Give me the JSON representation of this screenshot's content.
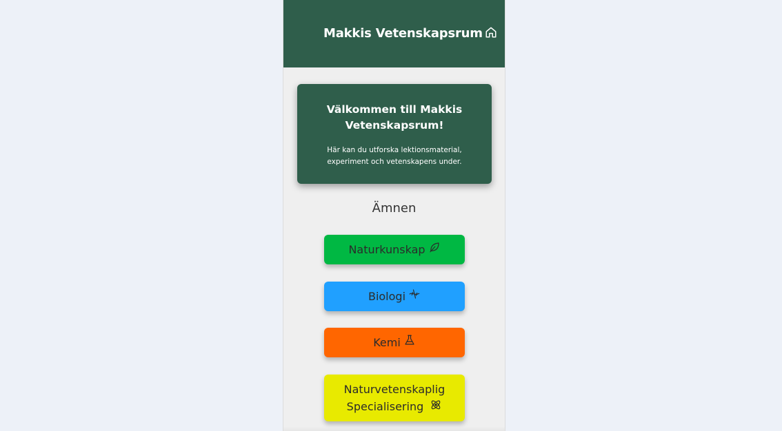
{
  "header": {
    "title": "Makkis Vetenskapsrum",
    "home_icon": "home-icon",
    "background": "#2f5e4b"
  },
  "welcome": {
    "title": "Välkommen till Makkis Vetenskapsrum!",
    "text": "Här kan du utforska lektionsmaterial, experiment och vetenskapens under."
  },
  "subjects": {
    "heading": "Ämnen",
    "items": [
      {
        "label": "Naturkunskap",
        "icon": "leaf-icon",
        "color": "#00b843"
      },
      {
        "label": "Biologi",
        "icon": "dna-icon",
        "color": "#20a0ff"
      },
      {
        "label": "Kemi",
        "icon": "flask-icon",
        "color": "#ff6600"
      },
      {
        "label": "Naturvetenskaplig Specialisering",
        "icon": "atom-icon",
        "color": "#e8ea00"
      }
    ]
  }
}
